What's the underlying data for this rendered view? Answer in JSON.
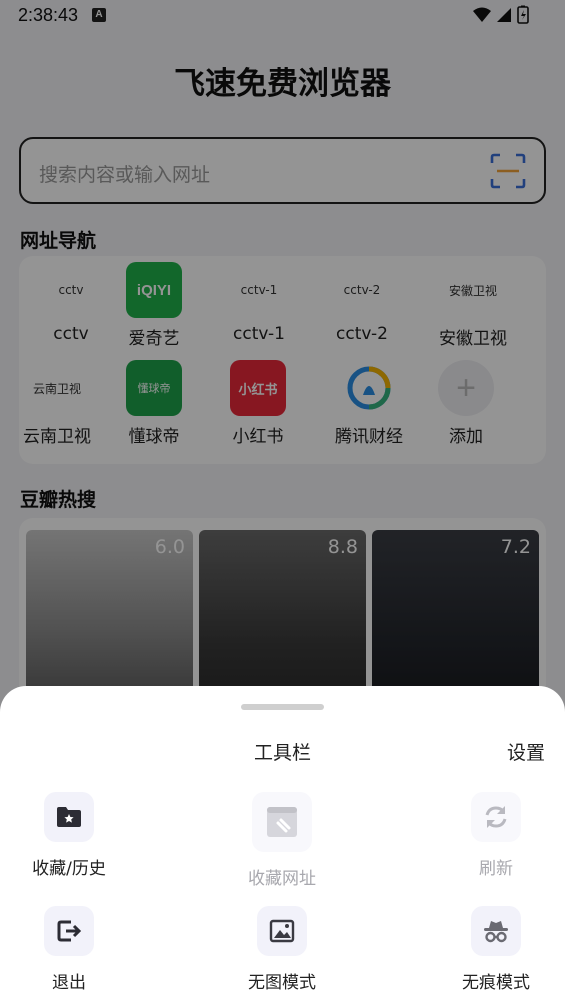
{
  "status_bar": {
    "time": "2:38:43",
    "notif_icon": "A"
  },
  "app": {
    "title": "飞速免费浏览器"
  },
  "search": {
    "placeholder": "搜索内容或输入网址"
  },
  "nav_section": {
    "title": "网址导航"
  },
  "nav_items": [
    {
      "label": "cctv",
      "icon_text": "cctv"
    },
    {
      "label": "爱奇艺",
      "icon_text": "iQIYI"
    },
    {
      "label": "cctv-1",
      "icon_text": "cctv-1"
    },
    {
      "label": "cctv-2",
      "icon_text": "cctv-2"
    },
    {
      "label": "安徽卫视",
      "icon_text": "安徽卫视"
    },
    {
      "label": "云南卫视",
      "icon_text": "云南卫视"
    },
    {
      "label": "懂球帝",
      "icon_text": "懂球帝"
    },
    {
      "label": "小红书",
      "icon_text": "小红书"
    },
    {
      "label": "腾讯财经",
      "icon_text": ""
    },
    {
      "label": "添加",
      "icon_text": "+"
    }
  ],
  "hot_section": {
    "title": "豆瓣热搜"
  },
  "posters": [
    {
      "score": "6.0"
    },
    {
      "score": "8.8"
    },
    {
      "score": "7.2"
    }
  ],
  "sheet": {
    "title": "工具栏",
    "settings_label": "设置",
    "tools": [
      {
        "label": "收藏/历史",
        "icon": "bookmark-folder-icon",
        "enabled": true
      },
      {
        "label": "收藏网址",
        "icon": "save-link-icon",
        "enabled": false
      },
      {
        "label": "刷新",
        "icon": "refresh-icon",
        "enabled": false
      },
      {
        "label": "退出",
        "icon": "exit-icon",
        "enabled": true
      },
      {
        "label": "无图模式",
        "icon": "image-icon",
        "enabled": true
      },
      {
        "label": "无痕模式",
        "icon": "incognito-icon",
        "enabled": true
      }
    ]
  },
  "colors": {
    "accent": "#3a6fd8",
    "scan_accent": "#f2a33a"
  }
}
